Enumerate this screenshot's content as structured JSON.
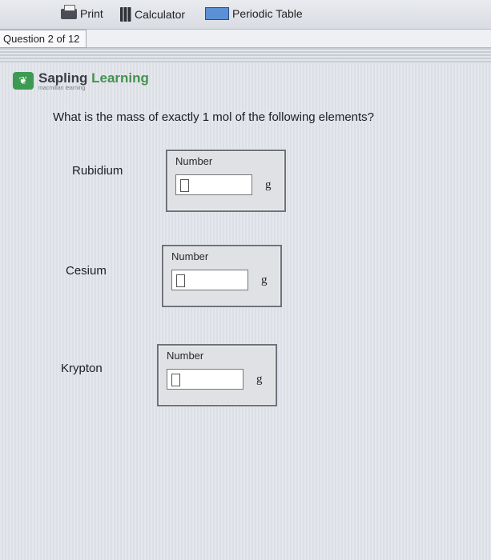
{
  "toolbar": {
    "print_label": "Print",
    "calculator_label": "Calculator",
    "periodic_table_label": "Periodic Table"
  },
  "question_tab": {
    "label": "Question 2 of 12"
  },
  "brand": {
    "name_part1": "Sapling",
    "name_part2": " Learning",
    "subtitle": "macmillan learning"
  },
  "question": {
    "text": "What is the mass of exactly 1 mol of the following elements?"
  },
  "elements": [
    {
      "label": "Rubidium",
      "field_label": "Number",
      "value": "",
      "unit": "g"
    },
    {
      "label": "Cesium",
      "field_label": "Number",
      "value": "",
      "unit": "g"
    },
    {
      "label": "Krypton",
      "field_label": "Number",
      "value": "",
      "unit": "g"
    }
  ],
  "colors": {
    "brand_green": "#45924f",
    "panel_bg": "#e4e7ec"
  }
}
